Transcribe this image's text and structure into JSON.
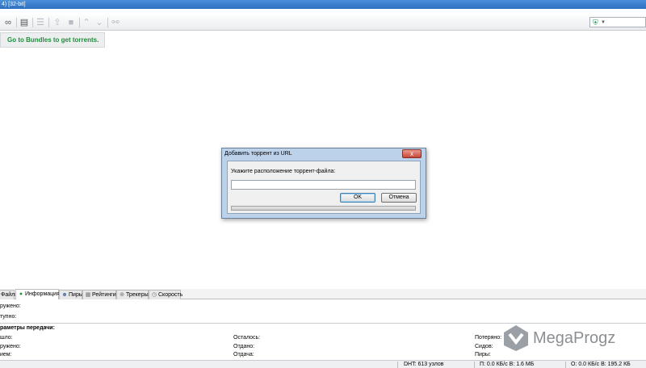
{
  "window": {
    "title": "4) [32-bit]"
  },
  "toolbar": {
    "icons": [
      "link-icon",
      "file-icon",
      "list-icon",
      "upload-icon",
      "stop-icon",
      "up-arrow-icon",
      "down-arrow-icon",
      "lock-icon"
    ],
    "search_shield": "shield-icon",
    "search_dropdown": "chevron-down-icon"
  },
  "bundles": {
    "label": "Go to Bundles to get torrents."
  },
  "dialog": {
    "title": "Добавить торрент из URL",
    "close_label": "x",
    "prompt": "Укажите расположение торрент-файла:",
    "url_value": "",
    "ok_label": "OK",
    "cancel_label": "Отмена"
  },
  "tabs": [
    {
      "label": "Файлы",
      "icon": "folder-icon"
    },
    {
      "label": "Информация",
      "icon": "info-icon",
      "active": true
    },
    {
      "label": "Пиры",
      "icon": "peers-icon"
    },
    {
      "label": "Рейтинги",
      "icon": "ratings-icon"
    },
    {
      "label": "Трекеры",
      "icon": "trackers-icon"
    },
    {
      "label": "Скорость",
      "icon": "speed-icon"
    }
  ],
  "info": {
    "downloaded_label": "ружено:",
    "available_label": "тупно:"
  },
  "transfer": {
    "title": "раметры передачи:",
    "rows": [
      {
        "c1": "шло:",
        "c2": "Осталось:",
        "c3": "Потеряно:"
      },
      {
        "c1": "ружено:",
        "c2": "Отдано:",
        "c3": "Сидов:"
      },
      {
        "c1": "ием:",
        "c2": "Отдача:",
        "c3": "Пиры:"
      }
    ]
  },
  "status": {
    "dht": "DHT: 613 узлов",
    "download": "П: 0.0 КБ/с В: 1.6 МБ",
    "upload": "О: 0.0 КБ/с В: 195.2 КБ"
  },
  "watermark": {
    "text": "MegaProgz"
  }
}
